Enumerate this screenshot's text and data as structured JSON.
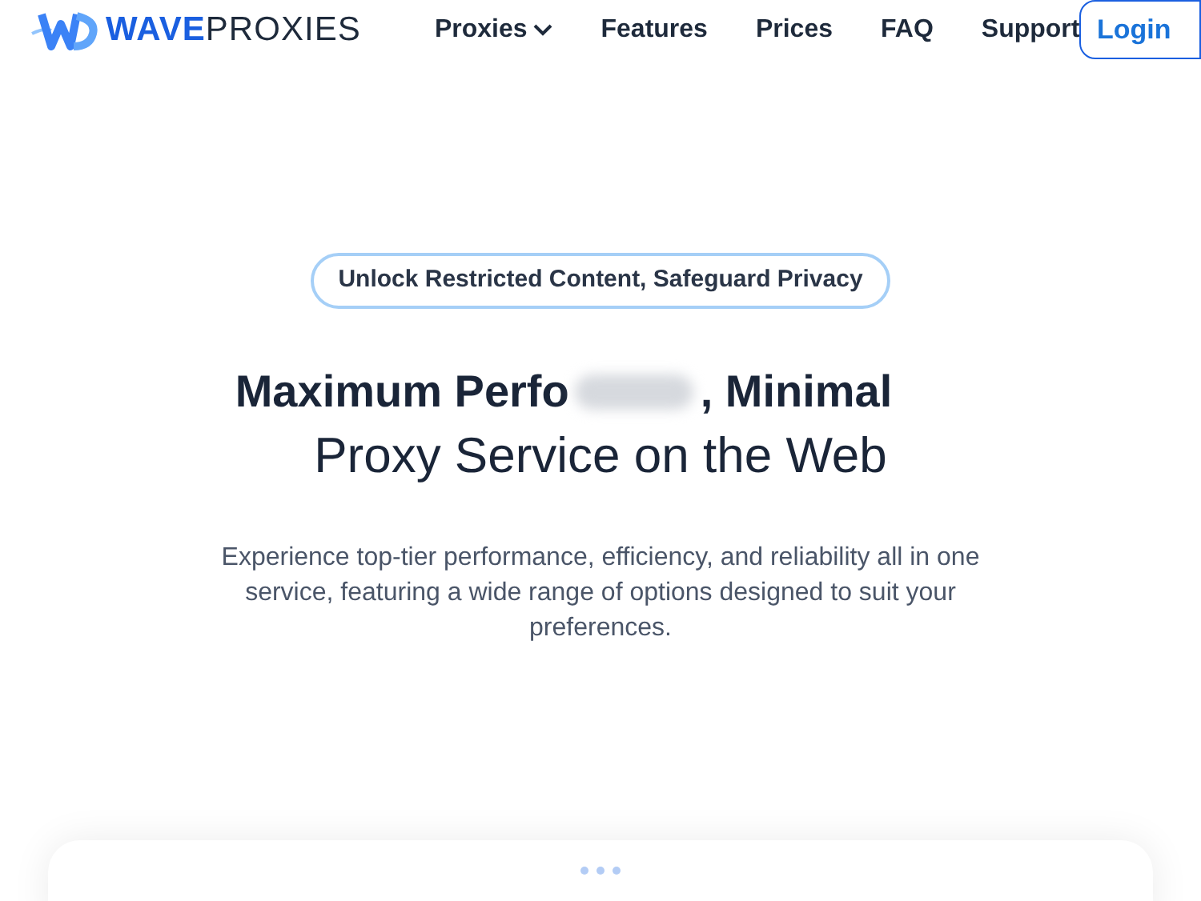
{
  "header": {
    "logo": {
      "brand_bold": "WAVE",
      "brand_light": "PROXIES"
    },
    "nav": [
      {
        "label": "Proxies",
        "kind": "dropdown"
      },
      {
        "label": "Features",
        "kind": "link"
      },
      {
        "label": "Prices",
        "kind": "link"
      },
      {
        "label": "FAQ",
        "kind": "link"
      },
      {
        "label": "Support",
        "kind": "link"
      }
    ],
    "login": "Login"
  },
  "hero": {
    "badge": "Unlock Restricted Content, Safeguard Privacy",
    "title_start": "Maximum Perfo",
    "title_end": ", Minimal",
    "title_line2": "Proxy Service on the Web",
    "description": "Experience top-tier performance, efficiency, and reliability all in one service, featuring a wide range of options designed to suit your preferences."
  }
}
